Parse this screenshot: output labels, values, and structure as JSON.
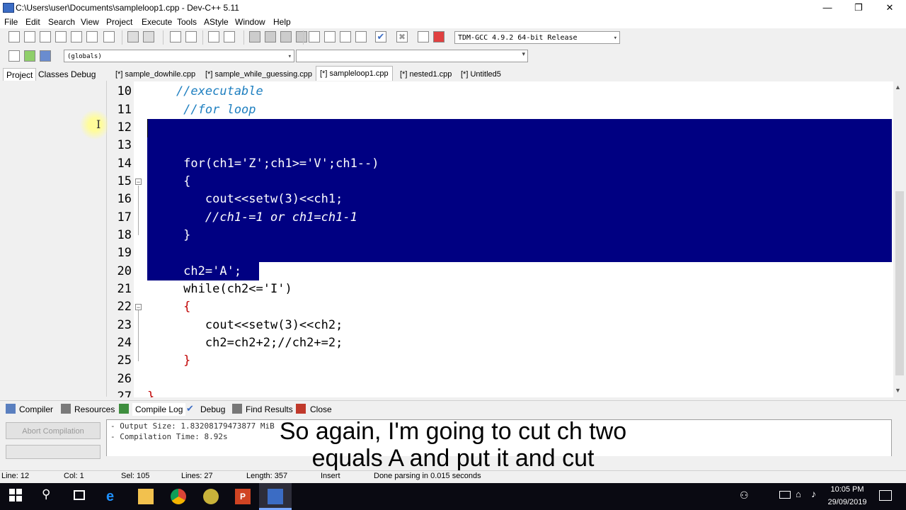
{
  "window": {
    "title": "C:\\Users\\user\\Documents\\sampleloop1.cpp - Dev-C++ 5.11",
    "minimize": "—",
    "restore": "❐",
    "close": "✕"
  },
  "menu": [
    "File",
    "Edit",
    "Search",
    "View",
    "Project",
    "Execute",
    "Tools",
    "AStyle",
    "Window",
    "Help"
  ],
  "toolbar": {
    "compiler": "TDM-GCC 4.9.2 64-bit Release",
    "scope": "(globals)"
  },
  "left_tabs": [
    "Project",
    "Classes",
    "Debug"
  ],
  "file_tabs": [
    {
      "label": "[*] sample_dowhile.cpp",
      "active": false
    },
    {
      "label": "[*] sample_while_guessing.cpp",
      "active": false
    },
    {
      "label": "[*] sampleloop1.cpp",
      "active": true
    },
    {
      "label": "[*] nested1.cpp",
      "active": false
    },
    {
      "label": "[*] Untitled5",
      "active": false
    }
  ],
  "editor": {
    "line_numbers": [
      "10",
      "11",
      "12",
      "13",
      "14",
      "15",
      "16",
      "17",
      "18",
      "19",
      "20",
      "21",
      "22",
      "23",
      "24",
      "25",
      "26",
      "27"
    ],
    "lines": [
      "    //executable",
      "     //for loop",
      "",
      "",
      "     for(ch1='Z';ch1>='V';ch1--)",
      "     {",
      "        cout<<setw(3)<<ch1;",
      "        //ch1-=1 or ch1=ch1-1",
      "     }",
      "",
      "     ch2='A';",
      "     while(ch2<='I')",
      "     {",
      "        cout<<setw(3)<<ch2;",
      "        ch2=ch2+2;//ch2+=2;",
      "     }",
      "",
      "}"
    ]
  },
  "bottom_tabs": [
    "Compiler",
    "Resources",
    "Compile Log",
    "Debug",
    "Find Results",
    "Close"
  ],
  "compile_log": {
    "abort_label": "Abort Compilation",
    "lines": [
      "- Output Size: 1.83208179473877 MiB",
      "- Compilation Time: 8.92s"
    ]
  },
  "caption": {
    "line1": "So again, I'm going to cut ch two",
    "line2": "equals A and put it and cut"
  },
  "status": {
    "line": "Line:   12",
    "col": "Col:   1",
    "sel": "Sel:   105",
    "lines": "Lines:   27",
    "length": "Length:   357",
    "mode": "Insert",
    "message": "Done parsing in 0.015 seconds"
  },
  "taskbar": {
    "time": "10:05 PM",
    "date": "29/09/2019"
  },
  "colors": {
    "selection": "#000082",
    "comment": "#1e7fc0",
    "symbol": "#c00000"
  }
}
